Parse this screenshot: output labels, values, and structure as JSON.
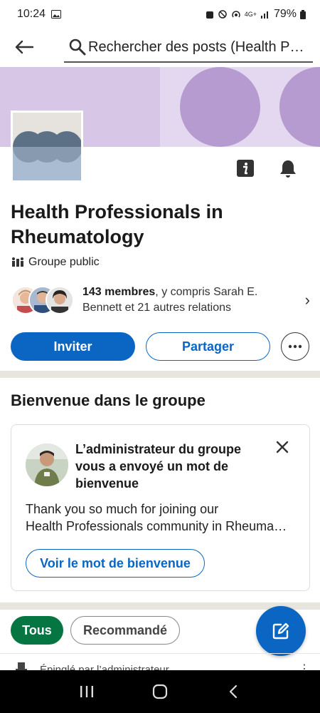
{
  "status_bar": {
    "time": "10:24",
    "network": "4G+",
    "battery": "79%"
  },
  "search": {
    "placeholder": "Rechercher des posts (Health Professionals in Rheumatology)"
  },
  "group": {
    "name": "Health Professionals in Rheumatology",
    "type_label": "Groupe public",
    "members_count": "143 membres",
    "members_detail": ", y compris Sarah E. Bennett et 21 autres relations"
  },
  "actions": {
    "invite": "Inviter",
    "share": "Partager"
  },
  "welcome": {
    "heading": "Bienvenue dans le groupe",
    "card_title": "L’administrateur du groupe vous a envoyé un mot de bienvenue",
    "message_line1": "Thank you so much for joining our",
    "message_line2": "Health Professionals community in Rheumatology",
    "button": "Voir le mot de bienvenue"
  },
  "filters": {
    "all": "Tous",
    "recommended": "Recommandé"
  },
  "pinned": {
    "label": "Épinglé par l’administrateur"
  },
  "colors": {
    "accent": "#0a66c2",
    "chip_active": "#057642",
    "banner": "#d7c6e6",
    "banner_circle": "#b69bd0",
    "separator": "#e8e5df"
  },
  "icons": {
    "back": "arrow-left-icon",
    "search": "search-icon",
    "info": "info-icon",
    "bell": "bell-icon",
    "group_type": "people-icon",
    "chevron": "chevron-right-icon",
    "more": "more-icon",
    "close": "close-icon",
    "compose": "compose-icon",
    "pin": "pin-icon"
  }
}
